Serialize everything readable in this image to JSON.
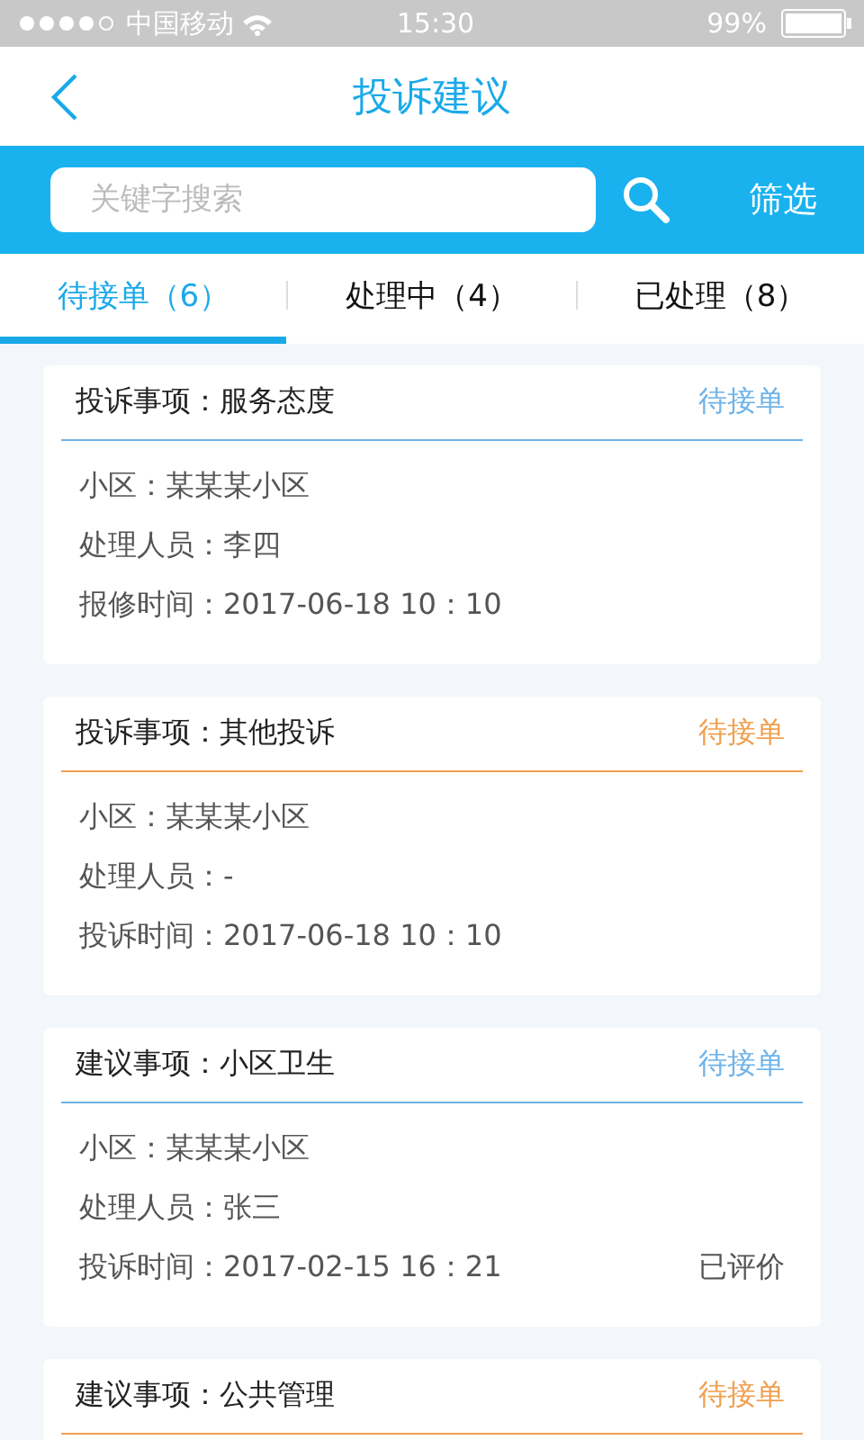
{
  "status_bar": {
    "carrier": "中国移动",
    "time": "15:30",
    "battery": "99%"
  },
  "nav": {
    "title": "投诉建议"
  },
  "search": {
    "placeholder": "关键字搜索",
    "filter": "筛选"
  },
  "tabs": [
    {
      "label": "待接单（6）",
      "selected": true
    },
    {
      "label": "处理中（4）",
      "selected": false
    },
    {
      "label": "已处理（8）",
      "selected": false
    }
  ],
  "cards": [
    {
      "title": "投诉事项：服务态度",
      "status": "待接单",
      "color": "#6fb3e8",
      "lines": [
        "小区：某某某小区",
        "处理人员：李四",
        "报修时间：2017-06-18 10：10"
      ]
    },
    {
      "title": "投诉事项：其他投诉",
      "status": "待接单",
      "color": "#f0a050",
      "lines": [
        "小区：某某某小区",
        "处理人员：-",
        "投诉时间：2017-06-18 10：10"
      ]
    },
    {
      "title": "建议事项：小区卫生",
      "status": "待接单",
      "color": "#6fb3e8",
      "lines": [
        "小区：某某某小区",
        "处理人员：张三",
        "投诉时间：2017-02-15 16：21"
      ],
      "note": "已评价"
    },
    {
      "title": "建议事项：公共管理",
      "status": "待接单",
      "color": "#f0a050"
    }
  ]
}
